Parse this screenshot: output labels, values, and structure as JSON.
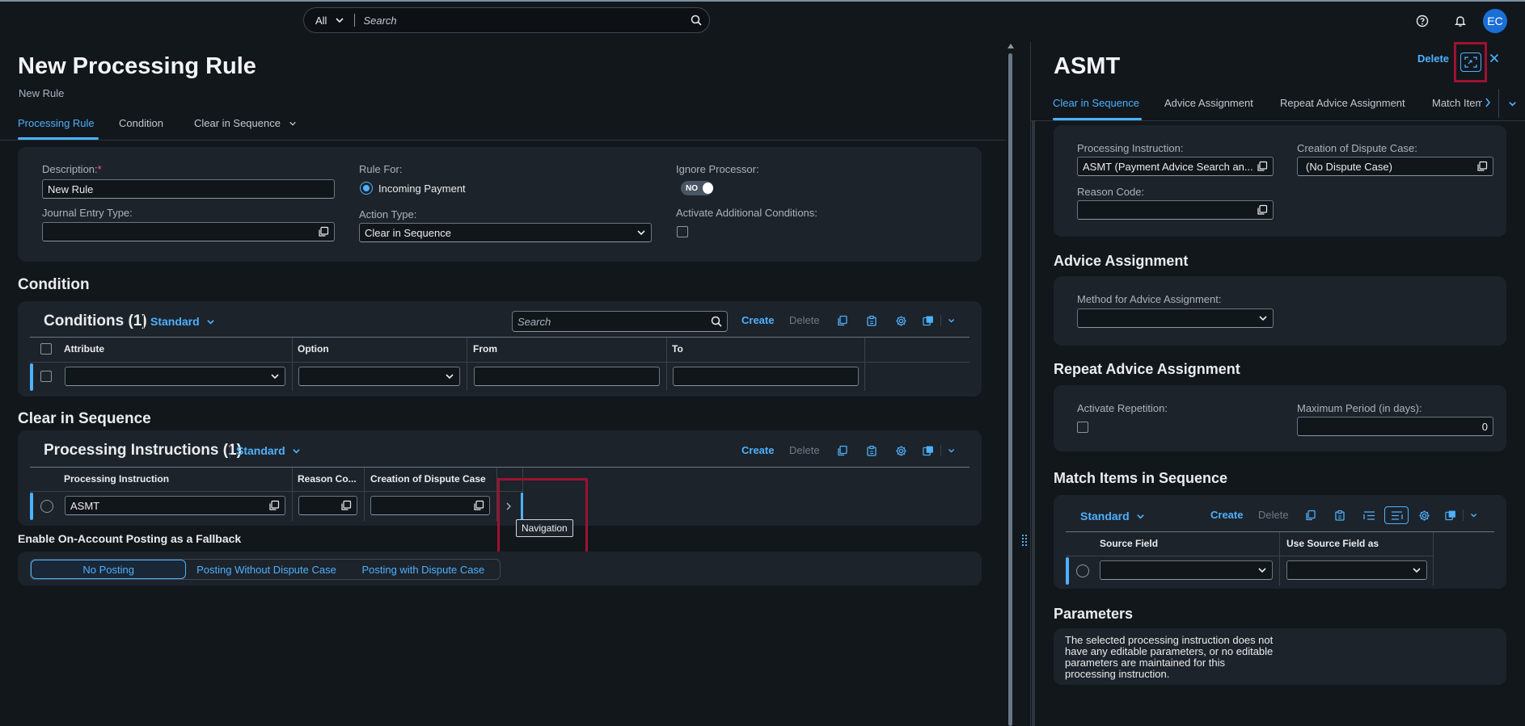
{
  "shell": {
    "search_scope": "All",
    "search_placeholder": "Search",
    "avatar_initials": "EC"
  },
  "page": {
    "title": "New Processing Rule",
    "subtitle": "New Rule",
    "tabs": [
      "Processing Rule",
      "Condition",
      "Clear in Sequence"
    ]
  },
  "form": {
    "description_label": "Description:",
    "required_mark": "*",
    "description_value": "New Rule",
    "journal_entry_type_label": "Journal Entry Type:",
    "journal_entry_type_value": "",
    "rule_for_label": "Rule For:",
    "rule_for_value": "Incoming Payment",
    "action_type_label": "Action Type:",
    "action_type_value": "Clear in Sequence",
    "ignore_processor_label": "Ignore Processor:",
    "ignore_processor_value": "NO",
    "activate_additional_label": "Activate Additional Conditions:"
  },
  "condition": {
    "section_title": "Condition",
    "table_title": "Conditions (1)",
    "variant": "Standard",
    "search_placeholder": "Search",
    "create_label": "Create",
    "delete_label": "Delete",
    "columns": [
      "Attribute",
      "Option",
      "From",
      "To"
    ]
  },
  "clear_in_sequence": {
    "section_title": "Clear in Sequence",
    "table_title": "Processing Instructions (1)",
    "variant": "Standard",
    "create_label": "Create",
    "delete_label": "Delete",
    "columns": [
      "Processing Instruction",
      "Reason Co...",
      "Creation of Dispute Case"
    ],
    "row": {
      "processing_instruction": "ASMT",
      "reason_code": "",
      "dispute_case": ""
    },
    "tooltip": "Navigation"
  },
  "fallback": {
    "title": "Enable On-Account Posting as a Fallback",
    "options": [
      "No Posting",
      "Posting Without Dispute Case",
      "Posting with Dispute Case"
    ],
    "selected": "No Posting"
  },
  "detail": {
    "title": "ASMT",
    "delete_label": "Delete",
    "tabs": [
      "Clear in Sequence",
      "Advice Assignment",
      "Repeat Advice Assignment",
      "Match Item"
    ],
    "processing_instruction_label": "Processing Instruction:",
    "processing_instruction_value": "ASMT (Payment Advice Search an...",
    "dispute_case_label": "Creation of Dispute Case:",
    "dispute_case_value": "(No Dispute Case)",
    "reason_code_label": "Reason Code:",
    "advice_assignment_title": "Advice Assignment",
    "method_label": "Method for Advice Assignment:",
    "repeat_title": "Repeat Advice Assignment",
    "activate_repetition_label": "Activate Repetition:",
    "max_period_label": "Maximum Period (in days):",
    "max_period_value": "0",
    "match_title": "Match Items in Sequence",
    "match_variant": "Standard",
    "match_create": "Create",
    "match_delete": "Delete",
    "match_columns": [
      "Source Field",
      "Use Source Field as"
    ],
    "parameters_title": "Parameters",
    "parameters_text": "The selected processing instruction does not have any editable parameters, or no editable parameters are maintained for this processing instruction."
  }
}
